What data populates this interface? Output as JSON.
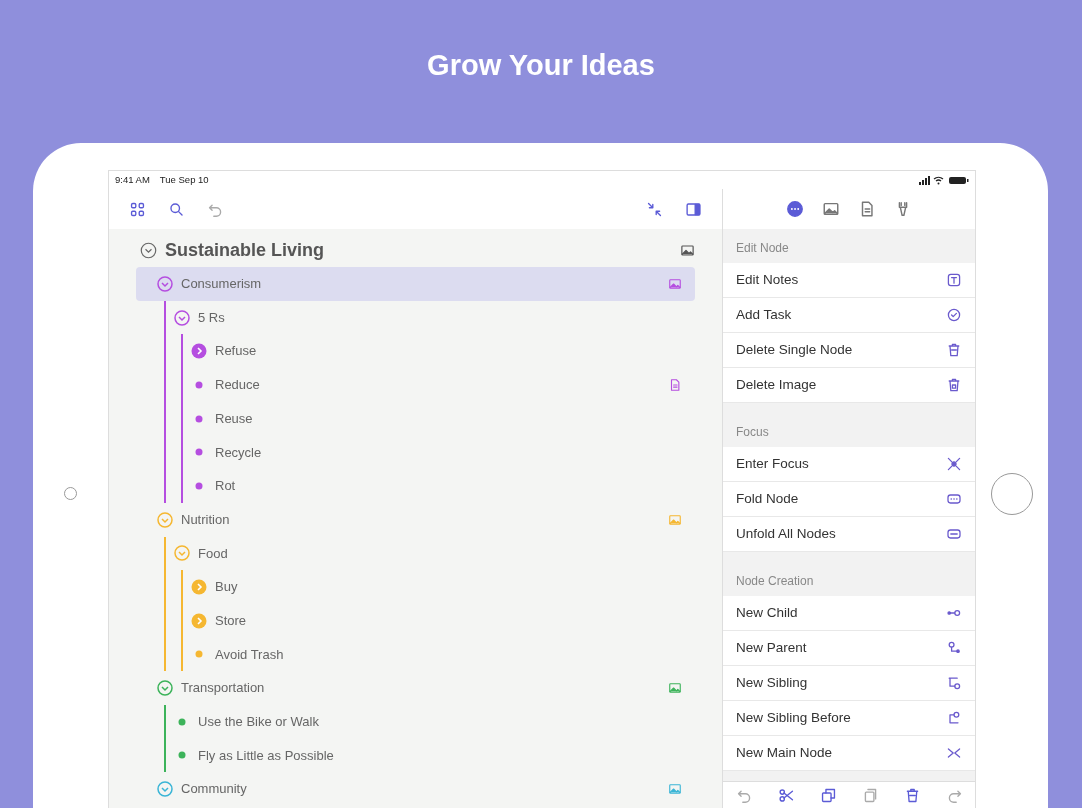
{
  "headline": "Grow Your Ideas",
  "status_bar": {
    "time": "9:41 AM",
    "date": "Tue Sep 10"
  },
  "toolbar": {
    "left": [
      {
        "kind": "grid",
        "disabled": false
      },
      {
        "kind": "search",
        "disabled": false
      },
      {
        "kind": "undo",
        "disabled": true
      }
    ],
    "right": [
      {
        "kind": "collapse",
        "disabled": false
      },
      {
        "kind": "sidebar",
        "disabled": false
      }
    ]
  },
  "outline": {
    "title": {
      "text": "Sustainable Living",
      "expanded": true,
      "has_image": true
    },
    "nodes": [
      {
        "text": "Consumerism",
        "kind": "expanded",
        "color": "#b54ee0",
        "selected": true,
        "has_image": true,
        "children": [
          {
            "text": "5 Rs",
            "kind": "expanded",
            "color": "#b54ee0",
            "selected": false,
            "children": [
              {
                "text": "Refuse",
                "kind": "collapsed",
                "color": "#b54ee0",
                "selected": false
              },
              {
                "text": "Reduce",
                "kind": "leaf",
                "color": "#b54ee0",
                "selected": false,
                "has_note": true
              },
              {
                "text": "Reuse",
                "kind": "leaf",
                "color": "#b54ee0",
                "selected": false
              },
              {
                "text": "Recycle",
                "kind": "leaf",
                "color": "#b54ee0",
                "selected": false
              },
              {
                "text": "Rot",
                "kind": "leaf",
                "color": "#b54ee0",
                "selected": false
              }
            ]
          }
        ]
      },
      {
        "text": "Nutrition",
        "kind": "expanded",
        "color": "#f5b731",
        "selected": false,
        "has_image": true,
        "children": [
          {
            "text": "Food",
            "kind": "expanded",
            "color": "#f5b731",
            "selected": false,
            "children": [
              {
                "text": "Buy",
                "kind": "collapsed",
                "color": "#f5b731",
                "selected": false
              },
              {
                "text": "Store",
                "kind": "collapsed",
                "color": "#f5b731",
                "selected": false
              },
              {
                "text": "Avoid Trash",
                "kind": "leaf",
                "color": "#f5b731",
                "selected": false
              }
            ]
          }
        ]
      },
      {
        "text": "Transportation",
        "kind": "expanded",
        "color": "#3cb35a",
        "selected": false,
        "has_image": true,
        "children": [
          {
            "text": "Use the Bike or Walk",
            "kind": "leaf",
            "color": "#3cb35a",
            "selected": false
          },
          {
            "text": "Fly as Little as Possible",
            "kind": "leaf",
            "color": "#3cb35a",
            "selected": false
          }
        ]
      },
      {
        "text": "Community",
        "kind": "expanded",
        "color": "#3ab5d6",
        "selected": false,
        "has_image": true
      }
    ]
  },
  "panel": {
    "tabs": [
      {
        "kind": "more",
        "selected": true
      },
      {
        "kind": "image",
        "selected": false
      },
      {
        "kind": "note",
        "selected": false
      },
      {
        "kind": "style",
        "selected": false
      }
    ],
    "sections": [
      {
        "title": "Edit Node",
        "items": [
          {
            "label": "Edit Notes",
            "kind": "notes"
          },
          {
            "label": "Add Task",
            "kind": "task"
          },
          {
            "label": "Delete Single Node",
            "kind": "trash"
          },
          {
            "label": "Delete Image",
            "kind": "trash-image"
          }
        ]
      },
      {
        "title": "Focus",
        "items": [
          {
            "label": "Enter Focus",
            "kind": "focus"
          },
          {
            "label": "Fold Node",
            "kind": "fold"
          },
          {
            "label": "Unfold All Nodes",
            "kind": "unfold"
          }
        ]
      },
      {
        "title": "Node Creation",
        "items": [
          {
            "label": "New Child",
            "kind": "child"
          },
          {
            "label": "New Parent",
            "kind": "parent"
          },
          {
            "label": "New Sibling",
            "kind": "sibling"
          },
          {
            "label": "New Sibling Before",
            "kind": "sibling-before"
          },
          {
            "label": "New Main Node",
            "kind": "main-node"
          }
        ]
      }
    ],
    "bottom_toolbar": [
      {
        "kind": "undo",
        "disabled": true
      },
      {
        "kind": "cut",
        "disabled": false
      },
      {
        "kind": "copy",
        "disabled": false
      },
      {
        "kind": "paste",
        "disabled": true
      },
      {
        "kind": "trash",
        "disabled": false
      },
      {
        "kind": "redo",
        "disabled": true
      }
    ]
  }
}
